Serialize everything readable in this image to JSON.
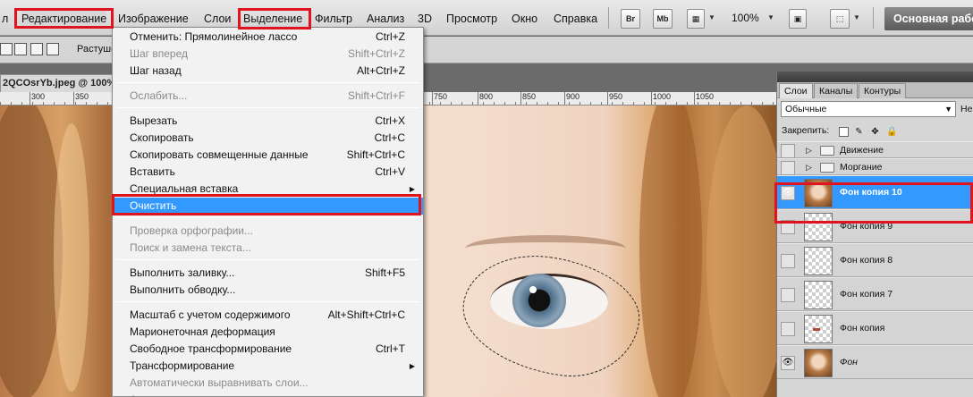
{
  "menubar": {
    "items": [
      {
        "label": "л",
        "active": false
      },
      {
        "label": "Редактирование",
        "active": true
      },
      {
        "label": "Изображение",
        "active": false
      },
      {
        "label": "Слои",
        "active": false
      },
      {
        "label": "Выделение",
        "active": false
      },
      {
        "label": "Фильтр",
        "active": false
      },
      {
        "label": "Анализ",
        "active": false
      },
      {
        "label": "3D",
        "active": false
      },
      {
        "label": "Просмотр",
        "active": false
      },
      {
        "label": "Окно",
        "active": false
      },
      {
        "label": "Справка",
        "active": false
      }
    ],
    "bridge_label": "Br",
    "minibridge_label": "Mb",
    "zoom": "100%",
    "workspace": "Основная рабочая"
  },
  "options": {
    "feather_label": "Растушевка"
  },
  "document": {
    "tab_title": "2QCOsrYb.jpeg @ 100%",
    "ruler_labels": [
      "300",
      "350",
      "750",
      "800",
      "850",
      "900",
      "950",
      "1000",
      "1050"
    ]
  },
  "edit_menu": {
    "items": [
      {
        "type": "item",
        "label": "Отменить: Прямолинейное лассо",
        "shortcut": "Ctrl+Z",
        "disabled": false
      },
      {
        "type": "item",
        "label": "Шаг вперед",
        "shortcut": "Shift+Ctrl+Z",
        "disabled": true
      },
      {
        "type": "item",
        "label": "Шаг назад",
        "shortcut": "Alt+Ctrl+Z",
        "disabled": false
      },
      {
        "type": "sep"
      },
      {
        "type": "item",
        "label": "Ослабить...",
        "shortcut": "Shift+Ctrl+F",
        "disabled": true
      },
      {
        "type": "sep"
      },
      {
        "type": "item",
        "label": "Вырезать",
        "shortcut": "Ctrl+X",
        "disabled": false
      },
      {
        "type": "item",
        "label": "Скопировать",
        "shortcut": "Ctrl+C",
        "disabled": false
      },
      {
        "type": "item",
        "label": "Скопировать совмещенные данные",
        "shortcut": "Shift+Ctrl+C",
        "disabled": false
      },
      {
        "type": "item",
        "label": "Вставить",
        "shortcut": "Ctrl+V",
        "disabled": false
      },
      {
        "type": "item",
        "label": "Специальная вставка",
        "shortcut": "",
        "submenu": true,
        "disabled": false
      },
      {
        "type": "item",
        "label": "Очистить",
        "shortcut": "",
        "disabled": false,
        "selected": true
      },
      {
        "type": "sep"
      },
      {
        "type": "item",
        "label": "Проверка орфографии...",
        "shortcut": "",
        "disabled": true
      },
      {
        "type": "item",
        "label": "Поиск и замена текста...",
        "shortcut": "",
        "disabled": true
      },
      {
        "type": "sep"
      },
      {
        "type": "item",
        "label": "Выполнить заливку...",
        "shortcut": "Shift+F5",
        "disabled": false
      },
      {
        "type": "item",
        "label": "Выполнить обводку...",
        "shortcut": "",
        "disabled": false
      },
      {
        "type": "sep"
      },
      {
        "type": "item",
        "label": "Масштаб с учетом содержимого",
        "shortcut": "Alt+Shift+Ctrl+C",
        "disabled": false
      },
      {
        "type": "item",
        "label": "Марионеточная деформация",
        "shortcut": "",
        "disabled": false
      },
      {
        "type": "item",
        "label": "Свободное трансформирование",
        "shortcut": "Ctrl+T",
        "disabled": false
      },
      {
        "type": "item",
        "label": "Трансформирование",
        "shortcut": "",
        "submenu": true,
        "disabled": false
      },
      {
        "type": "item",
        "label": "Автоматически выравнивать слои...",
        "shortcut": "",
        "disabled": true
      },
      {
        "type": "item",
        "label": "А",
        "shortcut": "",
        "disabled": true
      }
    ]
  },
  "layers_panel": {
    "tabs": [
      {
        "label": "Слои",
        "active": true
      },
      {
        "label": "Каналы",
        "active": false
      },
      {
        "label": "Контуры",
        "active": false
      }
    ],
    "blend_mode": "Обычные",
    "opacity_label": "Неп",
    "lock_label": "Закрепить:",
    "layers": [
      {
        "name": "Движение",
        "group": true,
        "visible": false,
        "selected": false,
        "thumb": "none"
      },
      {
        "name": "Моргание",
        "group": true,
        "visible": false,
        "selected": false,
        "thumb": "none"
      },
      {
        "name": "Фон копия 10",
        "group": false,
        "visible": true,
        "selected": true,
        "thumb": "photo"
      },
      {
        "name": "Фон копия 9",
        "group": false,
        "visible": false,
        "selected": false,
        "thumb": "transparent"
      },
      {
        "name": "Фон копия 8",
        "group": false,
        "visible": false,
        "selected": false,
        "thumb": "transparent"
      },
      {
        "name": "Фон копия 7",
        "group": false,
        "visible": false,
        "selected": false,
        "thumb": "transparent"
      },
      {
        "name": "Фон копия",
        "group": false,
        "visible": false,
        "selected": false,
        "thumb": "spot"
      },
      {
        "name": "Фон",
        "group": false,
        "visible": true,
        "selected": false,
        "thumb": "photo",
        "italic": true
      }
    ]
  },
  "annotations": {
    "highlight_color": "#e0141f"
  }
}
